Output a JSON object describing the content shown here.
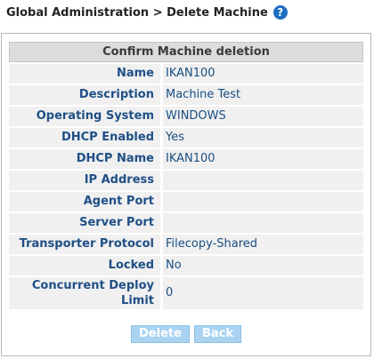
{
  "header": {
    "breadcrumb": "Global Administration > Delete Machine",
    "help_icon": "?"
  },
  "panel": {
    "title": "Confirm Machine deletion",
    "rows": [
      {
        "label": "Name",
        "value": "IKAN100"
      },
      {
        "label": "Description",
        "value": "Machine Test"
      },
      {
        "label": "Operating System",
        "value": "WINDOWS"
      },
      {
        "label": "DHCP Enabled",
        "value": "Yes"
      },
      {
        "label": "DHCP Name",
        "value": "IKAN100"
      },
      {
        "label": "IP Address",
        "value": ""
      },
      {
        "label": "Agent Port",
        "value": ""
      },
      {
        "label": "Server Port",
        "value": ""
      },
      {
        "label": "Transporter Protocol",
        "value": "Filecopy-Shared"
      },
      {
        "label": "Locked",
        "value": "No"
      },
      {
        "label": "Concurrent Deploy Limit",
        "value": "0"
      }
    ]
  },
  "actions": {
    "delete_label": "Delete",
    "back_label": "Back"
  },
  "colors": {
    "label_text": "#1f4f86",
    "button_bg": "#a9d3f0",
    "help_icon_bg": "#1f6fc0"
  }
}
